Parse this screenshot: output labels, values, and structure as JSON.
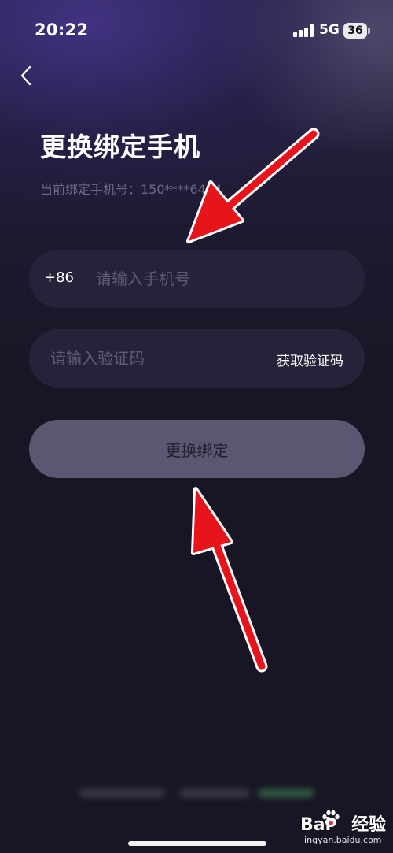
{
  "status_bar": {
    "time": "20:22",
    "network": "5G",
    "battery": "36"
  },
  "page": {
    "title": "更换绑定手机",
    "current_phone": "当前绑定手机号：150****6484"
  },
  "phone_field": {
    "country_code": "+86",
    "placeholder": "请输入手机号"
  },
  "code_field": {
    "placeholder": "请输入验证码",
    "get_code_label": "获取验证码"
  },
  "submit": {
    "label": "更换绑定"
  },
  "watermark": {
    "brand_left": "Bai",
    "brand_right": "经验",
    "site": "jingyan.baidu.com"
  },
  "colors": {
    "background": "#181624",
    "field": "#25233a",
    "button": "#595772",
    "annotation_arrow": "#e8141b"
  },
  "icons": {
    "back": "chevron-left-icon",
    "signal": "cellular-signal-icon",
    "battery": "battery-icon"
  }
}
